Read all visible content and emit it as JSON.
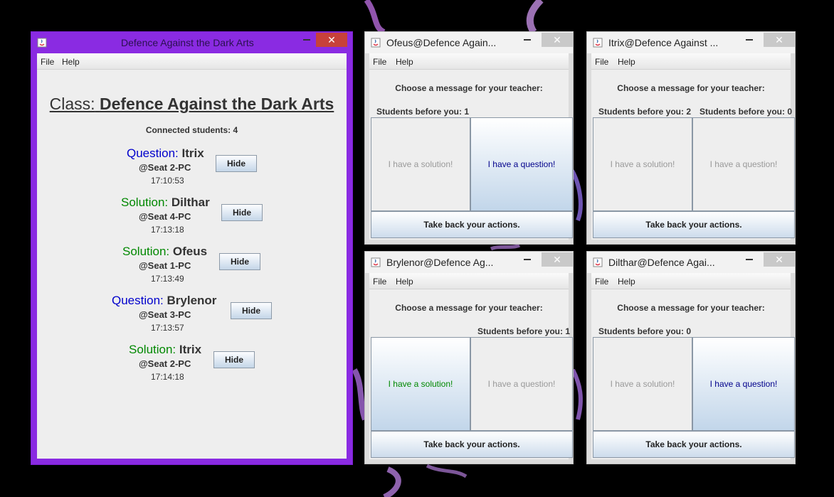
{
  "desktop": {
    "background": "#000000",
    "accent": "#8a2be2"
  },
  "teacher": {
    "window_title": "Defence Against the Dark Arts",
    "menu": {
      "file": "File",
      "help": "Help"
    },
    "class_label": "Class:",
    "class_name": "Defence Against the Dark Arts",
    "connected": "Connected students: 4",
    "entries": [
      {
        "kind": "Question:",
        "name": "Itrix",
        "seat": "@Seat 2-PC",
        "time": "17:10:53",
        "button": "Hide"
      },
      {
        "kind": "Solution:",
        "name": "Dilthar",
        "seat": "@Seat 4-PC",
        "time": "17:13:18",
        "button": "Hide"
      },
      {
        "kind": "Solution:",
        "name": "Ofeus",
        "seat": "@Seat 1-PC",
        "time": "17:13:49",
        "button": "Hide"
      },
      {
        "kind": "Question:",
        "name": "Brylenor",
        "seat": "@Seat 3-PC",
        "time": "17:13:57",
        "button": "Hide"
      },
      {
        "kind": "Solution:",
        "name": "Itrix",
        "seat": "@Seat 2-PC",
        "time": "17:14:18",
        "button": "Hide"
      }
    ],
    "colors": {
      "question": "#0000cc",
      "solution": "#008800"
    }
  },
  "students": [
    {
      "window_title": "Ofeus@Defence Again...",
      "menu": {
        "file": "File",
        "help": "Help"
      },
      "choose": "Choose a message for your teacher:",
      "before": "Students before you: 1",
      "solution_btn": "I have a solution!",
      "question_btn": "I have a question!",
      "active": "question",
      "takeback": "Take back your actions."
    },
    {
      "window_title": "Itrix@Defence Against ...",
      "menu": {
        "file": "File",
        "help": "Help"
      },
      "choose": "Choose a message for your teacher:",
      "before": "Students before you: 2",
      "before_second": "Students before you: 0",
      "solution_btn": "I have a solution!",
      "question_btn": "I have a question!",
      "active": "none",
      "takeback": "Take back your actions."
    },
    {
      "window_title": "Brylenor@Defence Ag...",
      "menu": {
        "file": "File",
        "help": "Help"
      },
      "choose": "Choose a message for your teacher:",
      "before": "Students before you: 1",
      "solution_btn": "I have a solution!",
      "question_btn": "I have a question!",
      "active": "solution",
      "takeback": "Take back your actions."
    },
    {
      "window_title": "Dilthar@Defence Agai...",
      "menu": {
        "file": "File",
        "help": "Help"
      },
      "choose": "Choose a message for your teacher:",
      "before": "Students before you: 0",
      "solution_btn": "I have a solution!",
      "question_btn": "I have a question!",
      "active": "question",
      "takeback": "Take back your actions."
    }
  ],
  "icons": {
    "app": "java-icon",
    "minimize": "minimize-icon",
    "close": "close-icon"
  }
}
